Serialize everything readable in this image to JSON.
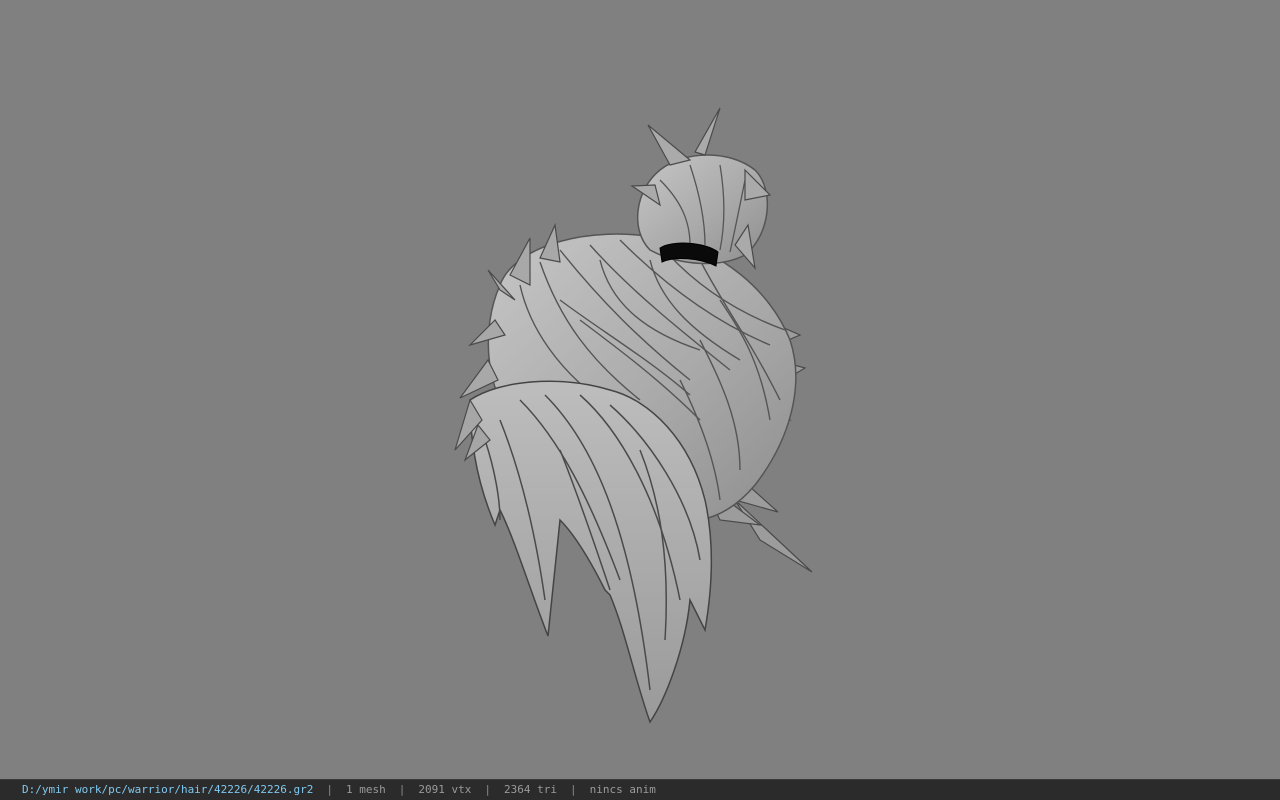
{
  "viewport": {
    "background_color": "#808080",
    "model": {
      "icon": "hair-mesh-icon",
      "base_color": "#b4b4b4",
      "shadow_color": "#4a4a4a",
      "band_color": "#0a0a0a"
    }
  },
  "statusbar": {
    "file_path": "D:/ymir work/pc/warrior/hair/42226/42226.gr2",
    "separator": "|",
    "mesh_count": "1 mesh",
    "vertex_count": "2091 vtx",
    "triangle_count": "2364 tri",
    "anim_status": "nincs anim",
    "path_color": "#7fc8ef"
  }
}
